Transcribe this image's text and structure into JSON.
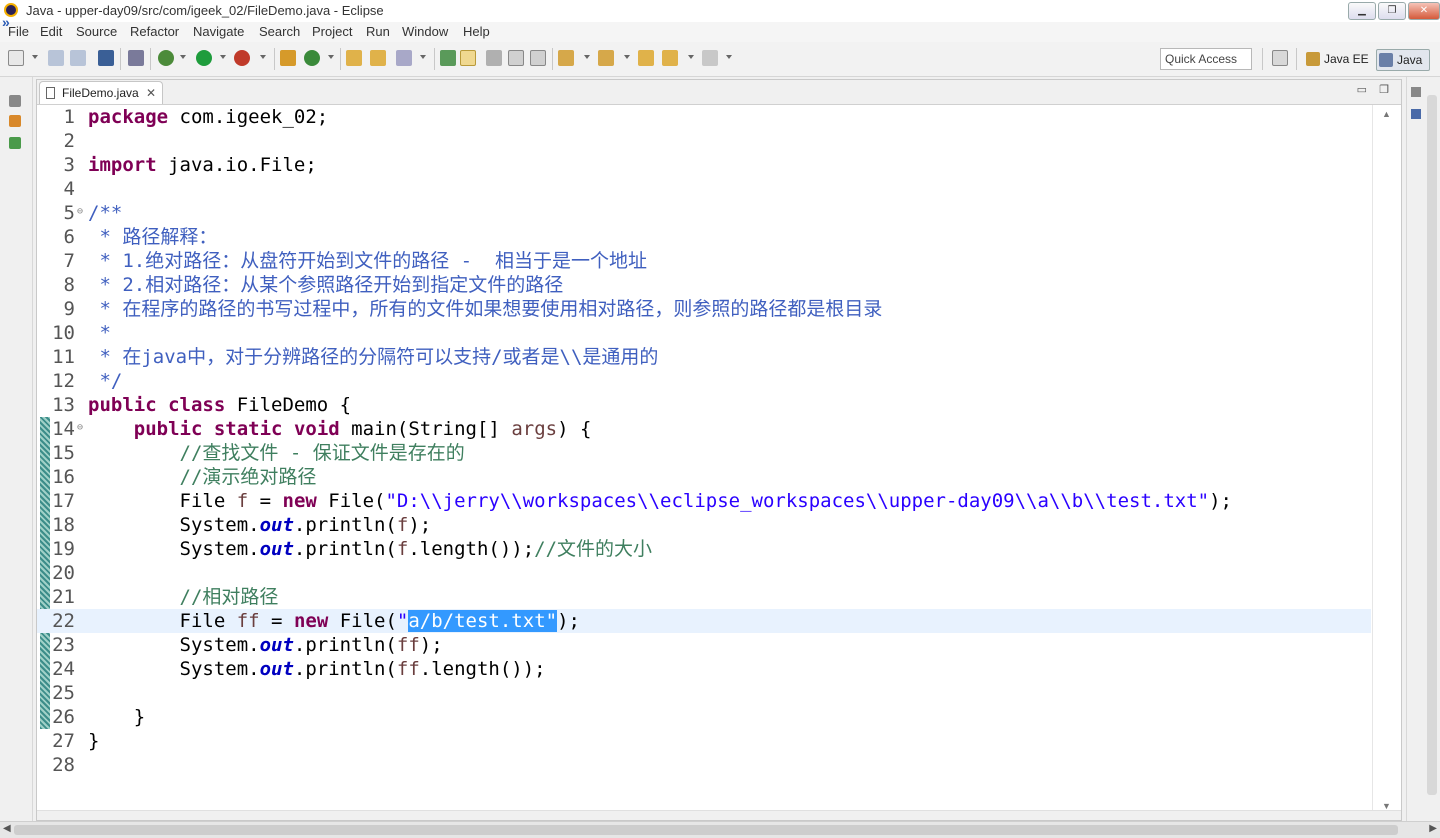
{
  "window": {
    "title": "Java - upper-day09/src/com/igeek_02/FileDemo.java - Eclipse",
    "minimize": "▁",
    "maximize": "❐",
    "close": "✕"
  },
  "menu": [
    "File",
    "Edit",
    "Source",
    "Refactor",
    "Navigate",
    "Search",
    "Project",
    "Run",
    "Window",
    "Help"
  ],
  "toolbar": {
    "quick_access": "Quick Access",
    "perspectives": [
      "Java EE",
      "Java"
    ]
  },
  "editor": {
    "tab_label": "FileDemo.java",
    "tab_close": "✕",
    "current_line": 22,
    "lines": [
      {
        "n": "1",
        "segs": [
          {
            "t": "package",
            "c": "kw"
          },
          {
            "t": " com.igeek_02;",
            "c": ""
          }
        ]
      },
      {
        "n": "2",
        "segs": []
      },
      {
        "n": "3",
        "segs": [
          {
            "t": "import",
            "c": "kw"
          },
          {
            "t": " java.io.File;",
            "c": ""
          }
        ]
      },
      {
        "n": "4",
        "segs": []
      },
      {
        "n": "5",
        "fold": true,
        "segs": [
          {
            "t": "/**",
            "c": "jdoc"
          }
        ]
      },
      {
        "n": "6",
        "segs": [
          {
            "t": " * 路径解释：",
            "c": "jdoc"
          }
        ]
      },
      {
        "n": "7",
        "segs": [
          {
            "t": " * 1.绝对路径：从盘符开始到文件的路径 -  相当于是一个地址",
            "c": "jdoc"
          }
        ]
      },
      {
        "n": "8",
        "segs": [
          {
            "t": " * 2.相对路径：从某个参照路径开始到指定文件的路径",
            "c": "jdoc"
          }
        ]
      },
      {
        "n": "9",
        "segs": [
          {
            "t": " * 在程序的路径的书写过程中，所有的文件如果想要使用相对路径，则参照的路径都是根目录",
            "c": "jdoc"
          }
        ]
      },
      {
        "n": "10",
        "segs": [
          {
            "t": " *",
            "c": "jdoc"
          }
        ]
      },
      {
        "n": "11",
        "segs": [
          {
            "t": " * 在java中，对于分辨路径的分隔符可以支持/或者是\\\\是通用的",
            "c": "jdoc"
          }
        ]
      },
      {
        "n": "12",
        "segs": [
          {
            "t": " */",
            "c": "jdoc"
          }
        ]
      },
      {
        "n": "13",
        "segs": [
          {
            "t": "public",
            "c": "kw"
          },
          {
            "t": " ",
            "c": ""
          },
          {
            "t": "class",
            "c": "kw"
          },
          {
            "t": " FileDemo {",
            "c": ""
          }
        ]
      },
      {
        "n": "14",
        "fold": true,
        "segs": [
          {
            "t": "    ",
            "c": ""
          },
          {
            "t": "public",
            "c": "kw"
          },
          {
            "t": " ",
            "c": ""
          },
          {
            "t": "static",
            "c": "kw"
          },
          {
            "t": " ",
            "c": ""
          },
          {
            "t": "void",
            "c": "kw"
          },
          {
            "t": " main(String[] ",
            "c": ""
          },
          {
            "t": "args",
            "c": "prm"
          },
          {
            "t": ") {",
            "c": ""
          }
        ]
      },
      {
        "n": "15",
        "segs": [
          {
            "t": "        ",
            "c": ""
          },
          {
            "t": "//查找文件 - 保证文件是存在的",
            "c": "cm"
          }
        ]
      },
      {
        "n": "16",
        "segs": [
          {
            "t": "        ",
            "c": ""
          },
          {
            "t": "//演示绝对路径",
            "c": "cm"
          }
        ]
      },
      {
        "n": "17",
        "segs": [
          {
            "t": "        File ",
            "c": ""
          },
          {
            "t": "f",
            "c": "prm"
          },
          {
            "t": " = ",
            "c": ""
          },
          {
            "t": "new",
            "c": "kw"
          },
          {
            "t": " File(",
            "c": ""
          },
          {
            "t": "\"D:\\\\jerry\\\\workspaces\\\\eclipse_workspaces\\\\upper-day09\\\\a\\\\b\\\\test.txt\"",
            "c": "str"
          },
          {
            "t": ");",
            "c": ""
          }
        ]
      },
      {
        "n": "18",
        "segs": [
          {
            "t": "        System.",
            "c": ""
          },
          {
            "t": "out",
            "c": "fld"
          },
          {
            "t": ".println(",
            "c": ""
          },
          {
            "t": "f",
            "c": "prm"
          },
          {
            "t": ");",
            "c": ""
          }
        ]
      },
      {
        "n": "19",
        "segs": [
          {
            "t": "        System.",
            "c": ""
          },
          {
            "t": "out",
            "c": "fld"
          },
          {
            "t": ".println(",
            "c": ""
          },
          {
            "t": "f",
            "c": "prm"
          },
          {
            "t": ".length());",
            "c": ""
          },
          {
            "t": "//文件的大小",
            "c": "cm"
          }
        ]
      },
      {
        "n": "20",
        "segs": []
      },
      {
        "n": "21",
        "segs": [
          {
            "t": "        ",
            "c": ""
          },
          {
            "t": "//相对路径",
            "c": "cm"
          }
        ]
      },
      {
        "n": "22",
        "segs": [
          {
            "t": "        File ",
            "c": ""
          },
          {
            "t": "ff",
            "c": "prm"
          },
          {
            "t": " = ",
            "c": ""
          },
          {
            "t": "new",
            "c": "kw"
          },
          {
            "t": " File(",
            "c": ""
          },
          {
            "t": "\"",
            "c": "str"
          },
          {
            "t": "a/b/test.txt\"",
            "c": "sel"
          },
          {
            "t": ");",
            "c": ""
          }
        ]
      },
      {
        "n": "23",
        "segs": [
          {
            "t": "        System.",
            "c": ""
          },
          {
            "t": "out",
            "c": "fld"
          },
          {
            "t": ".println(",
            "c": ""
          },
          {
            "t": "ff",
            "c": "prm"
          },
          {
            "t": ");",
            "c": ""
          }
        ]
      },
      {
        "n": "24",
        "segs": [
          {
            "t": "        System.",
            "c": ""
          },
          {
            "t": "out",
            "c": "fld"
          },
          {
            "t": ".println(",
            "c": ""
          },
          {
            "t": "ff",
            "c": "prm"
          },
          {
            "t": ".length());",
            "c": ""
          }
        ]
      },
      {
        "n": "25",
        "segs": []
      },
      {
        "n": "26",
        "segs": [
          {
            "t": "    }",
            "c": ""
          }
        ]
      },
      {
        "n": "27",
        "segs": [
          {
            "t": "}",
            "c": ""
          }
        ]
      },
      {
        "n": "28",
        "segs": []
      }
    ]
  },
  "colors": {
    "keyword": "#7f0055",
    "string": "#2a00ff",
    "javadoc": "#3f5fbf",
    "comment": "#3f7f5f",
    "field": "#0000c0",
    "selection": "#3399ff",
    "current_line": "#e8f2fe"
  }
}
